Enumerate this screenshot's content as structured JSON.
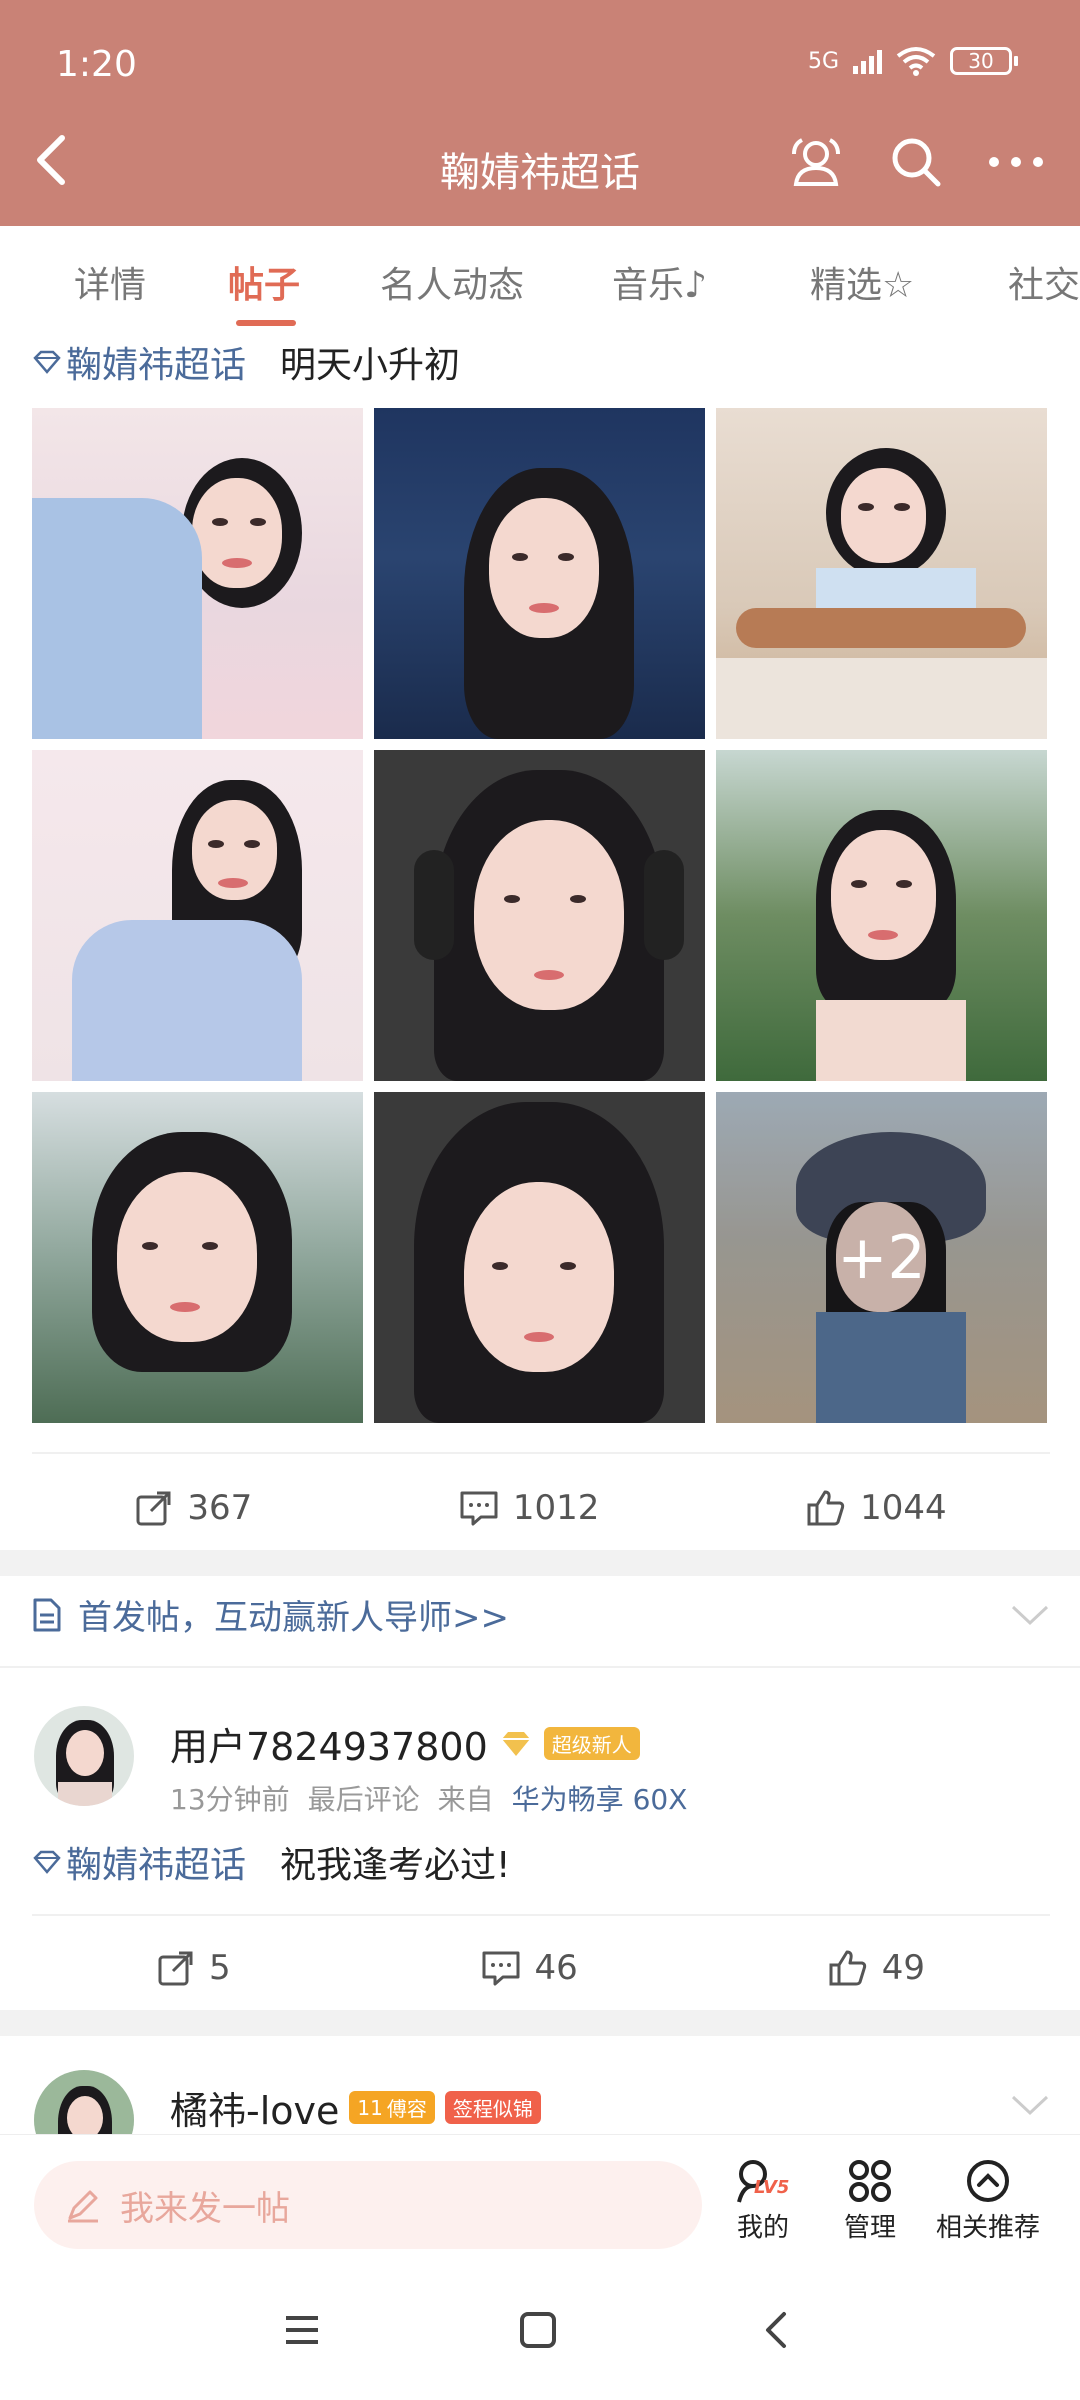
{
  "status_bar": {
    "time": "1:20",
    "network": "5G",
    "battery": "30"
  },
  "nav": {
    "title": "鞠婧祎超话"
  },
  "tabs": [
    "详情",
    "帖子",
    "名人动态",
    "音乐",
    "精选",
    "社交"
  ],
  "post1": {
    "topic": "鞠婧祎超话",
    "text": "明天小升初",
    "more_count": "+2",
    "shares": "367",
    "comments": "1012",
    "likes": "1044"
  },
  "notice": {
    "text": "首发帖，互动赢新人导师>>"
  },
  "post2": {
    "username": "用户7824937800",
    "badge": "超级新人",
    "time": "13分钟前",
    "last_comment": "最后评论",
    "from_label": "来自",
    "device": "华为畅享 60X",
    "topic": "鞠婧祎超话",
    "text": "祝我逢考必过!",
    "shares": "5",
    "comments": "46",
    "likes": "49"
  },
  "post3": {
    "username": "橘祎-love",
    "level": "11",
    "badge1": "傅容",
    "badge2": "签程似锦"
  },
  "bottom_bar": {
    "compose_placeholder": "我来发一帖",
    "mine": "我的",
    "manage": "管理",
    "recommend": "相关推荐",
    "level": "LV5"
  },
  "colors": {
    "header": "#c98276",
    "accent": "#e06b55",
    "link": "#4b6b9a"
  }
}
